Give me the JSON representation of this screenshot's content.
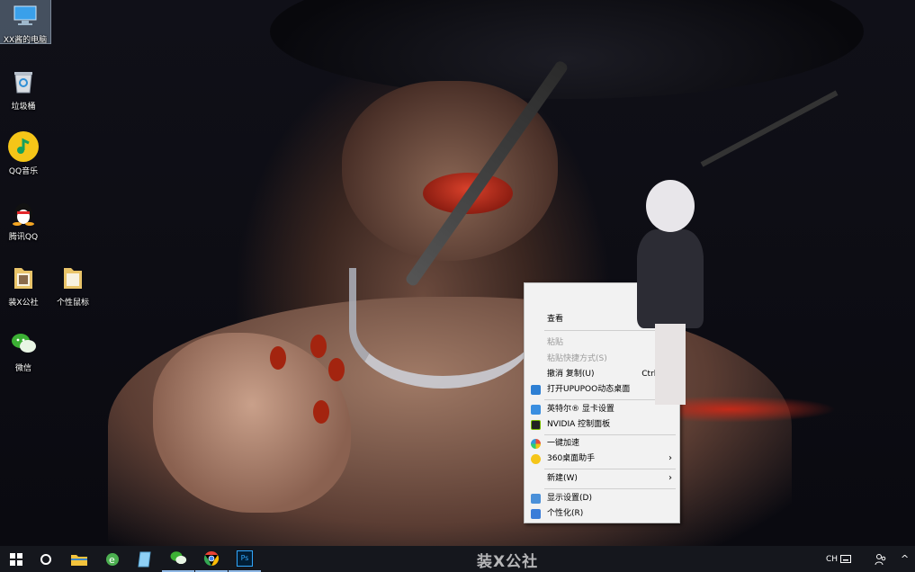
{
  "desktop": {
    "icons": [
      {
        "label": "XX酱的电脑",
        "icon": "computer-icon"
      },
      {
        "label": "垃圾桶",
        "icon": "recycle-bin-icon"
      },
      {
        "label": "QQ音乐",
        "icon": "qq-music-icon"
      },
      {
        "label": "腾讯QQ",
        "icon": "qq-penguin-icon"
      },
      {
        "label": "装X公社",
        "icon": "folder-icon"
      },
      {
        "label": "个性鼠标",
        "icon": "folder-icon"
      },
      {
        "label": "微信",
        "icon": "wechat-icon"
      }
    ]
  },
  "context_menu": {
    "items": [
      {
        "label": "查看",
        "shortcut": "",
        "disabled": false
      },
      {
        "label": "粘贴",
        "shortcut": "",
        "disabled": true
      },
      {
        "label": "粘贴快捷方式(S)",
        "shortcut": "",
        "disabled": true
      },
      {
        "label": "撤消 复制(U)",
        "shortcut": "Ctrl+Z",
        "disabled": false
      },
      {
        "label": "打开UPUPOO动态桌面",
        "shortcut": "",
        "disabled": false,
        "icon": "upupoo-icon"
      },
      {
        "label": "英特尔® 显卡设置",
        "shortcut": "",
        "disabled": false,
        "icon": "intel-graphics-icon"
      },
      {
        "label": "NVIDIA 控制面板",
        "shortcut": "",
        "disabled": false,
        "icon": "nvidia-icon"
      },
      {
        "label": "一键加速",
        "shortcut": "",
        "disabled": false,
        "icon": "speedup-icon"
      },
      {
        "label": "360桌面助手",
        "shortcut": "",
        "disabled": false,
        "icon": "360-icon",
        "submenu": true
      },
      {
        "label": "新建(W)",
        "shortcut": "",
        "disabled": false,
        "submenu": true
      },
      {
        "label": "显示设置(D)",
        "shortcut": "",
        "disabled": false,
        "icon": "display-icon"
      },
      {
        "label": "个性化(R)",
        "shortcut": "",
        "disabled": false,
        "icon": "personalize-icon"
      }
    ]
  },
  "taskbar": {
    "watermark": "装X公社",
    "apps": [
      "start-icon",
      "cortana-icon",
      "file-explorer-icon",
      "ie-icon",
      "notepad-icon",
      "wechat-icon",
      "chrome-icon",
      "photoshop-icon"
    ],
    "photoshop_label": "Ps",
    "tray": {
      "ime": "CH",
      "chevron": "^"
    }
  },
  "colors": {
    "taskbar": "#15171d",
    "menu_bg": "#f2f2f2",
    "accent": "#2d7fd3"
  }
}
